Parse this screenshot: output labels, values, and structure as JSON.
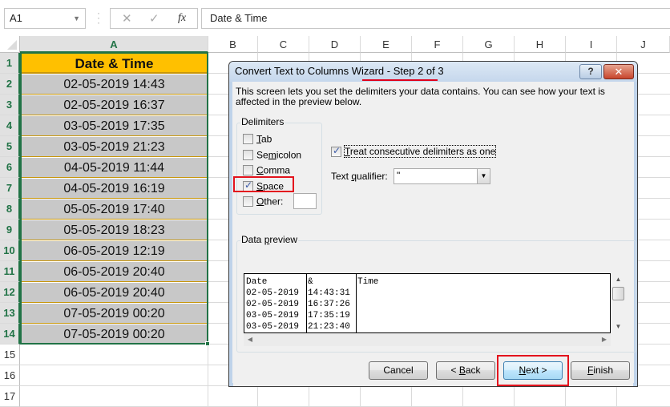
{
  "formula_bar": {
    "name_box": "A1",
    "cancel_icon": "✕",
    "enter_icon": "✓",
    "fx_label": "fx",
    "formula": "Date & Time"
  },
  "sheet": {
    "columns": [
      "A",
      "B",
      "C",
      "D",
      "E",
      "F",
      "G",
      "H",
      "I",
      "J"
    ],
    "selected_column": "A",
    "rows": [
      "1",
      "2",
      "3",
      "4",
      "5",
      "6",
      "7",
      "8",
      "9",
      "10",
      "11",
      "12",
      "13",
      "14",
      "15",
      "16",
      "17"
    ],
    "column_a": [
      "Date & Time",
      "02-05-2019 14:43",
      "02-05-2019 16:37",
      "03-05-2019 17:35",
      "03-05-2019 21:23",
      "04-05-2019 11:44",
      "04-05-2019 16:19",
      "05-05-2019 17:40",
      "05-05-2019 18:23",
      "06-05-2019 12:19",
      "06-05-2019 20:40",
      "06-05-2019 20:40",
      "07-05-2019 00:20",
      "07-05-2019 00:20"
    ],
    "header_color": "#ffc000",
    "data_fill_color": "#c8c8c8",
    "selection_color": "#217346"
  },
  "dialog": {
    "title_main": "Convert Text to Columns Wizard",
    "title_step": "- Step 2 of 3",
    "help_label": "?",
    "close_label": "✕",
    "description": "This screen lets you set the delimiters your data contains.  You can see how your text is affected in the preview below.",
    "delimiters_label": "Delimiters",
    "delimiters": [
      {
        "pre": "",
        "ul": "T",
        "post": "ab",
        "checked": false
      },
      {
        "pre": "Se",
        "ul": "m",
        "post": "icolon",
        "checked": false
      },
      {
        "pre": "",
        "ul": "C",
        "post": "omma",
        "checked": false
      },
      {
        "pre": "",
        "ul": "S",
        "post": "pace",
        "checked": true
      },
      {
        "pre": "",
        "ul": "O",
        "post": "ther:",
        "checked": false
      }
    ],
    "other_value": "",
    "treat_consecutive": {
      "pre": "",
      "ul": "T",
      "post": "reat consecutive delimiters as one",
      "checked": true
    },
    "text_qualifier_label": {
      "pre": "Text ",
      "ul": "q",
      "post": "ualifier:"
    },
    "text_qualifier_value": "\"",
    "data_preview_label": {
      "pre": "Data ",
      "ul": "p",
      "post": "review"
    },
    "preview_columns": [
      [
        "Date",
        "02-05-2019",
        "02-05-2019",
        "03-05-2019",
        "03-05-2019"
      ],
      [
        "&",
        "14:43:31",
        "16:37:26",
        "17:35:19",
        "21:23:40"
      ],
      [
        "Time",
        "",
        "",
        "",
        ""
      ]
    ],
    "buttons": {
      "cancel": {
        "pre": "Cancel",
        "ul": "",
        "post": ""
      },
      "back": {
        "pre": "< ",
        "ul": "B",
        "post": "ack"
      },
      "next": {
        "pre": "",
        "ul": "N",
        "post": "ext >"
      },
      "finish": {
        "pre": "",
        "ul": "F",
        "post": "inish"
      }
    },
    "highlight_color": "#e3131d"
  }
}
